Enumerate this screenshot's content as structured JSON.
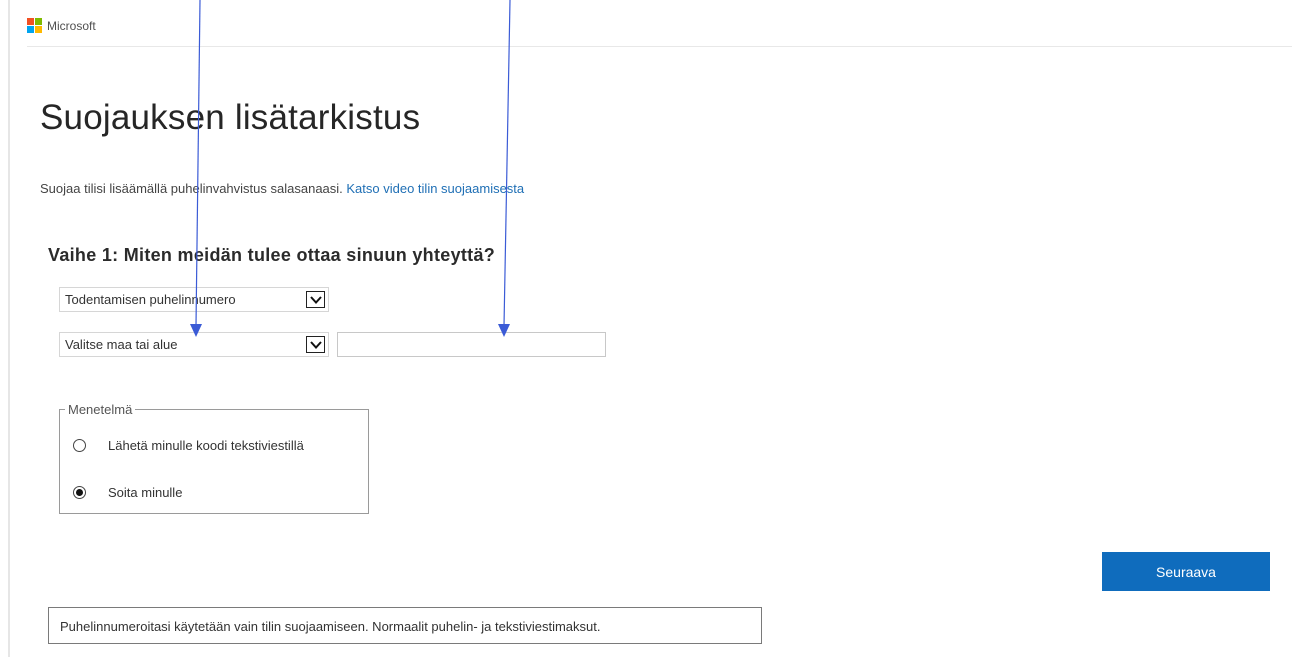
{
  "header": {
    "logo_text": "Microsoft",
    "logo_colors": [
      "#f25022",
      "#7fba00",
      "#00a4ef",
      "#ffb900"
    ]
  },
  "page": {
    "title": "Suojauksen lisätarkistus",
    "intro_text": "Suojaa tilisi lisäämällä puhelinvahvistus salasanaasi. ",
    "intro_link": "Katso video tilin suojaamisesta"
  },
  "step1": {
    "heading": "Vaihe 1: Miten meidän tulee ottaa sinuun yhteyttä?",
    "contact_method_select": "Todentamisen puhelinnumero",
    "country_select": "Valitse maa tai alue",
    "phone_input_value": ""
  },
  "method": {
    "legend": "Menetelmä",
    "options": [
      {
        "label": "Lähetä minulle koodi tekstiviestillä",
        "selected": false
      },
      {
        "label": "Soita minulle",
        "selected": true
      }
    ]
  },
  "actions": {
    "next_label": "Seuraava"
  },
  "notice": {
    "text": "Puhelinnumeroitasi käytetään vain tilin suojaamiseen. Normaalit puhelin- ja tekstiviestimaksut."
  },
  "colors": {
    "primary_button": "#0f6cbd",
    "link": "#1f6fb5",
    "annotation_arrow": "#3b5bd6"
  },
  "icons": [
    "microsoft-logo",
    "chevron-down-icon",
    "radio-icon",
    "annotation-arrow"
  ]
}
